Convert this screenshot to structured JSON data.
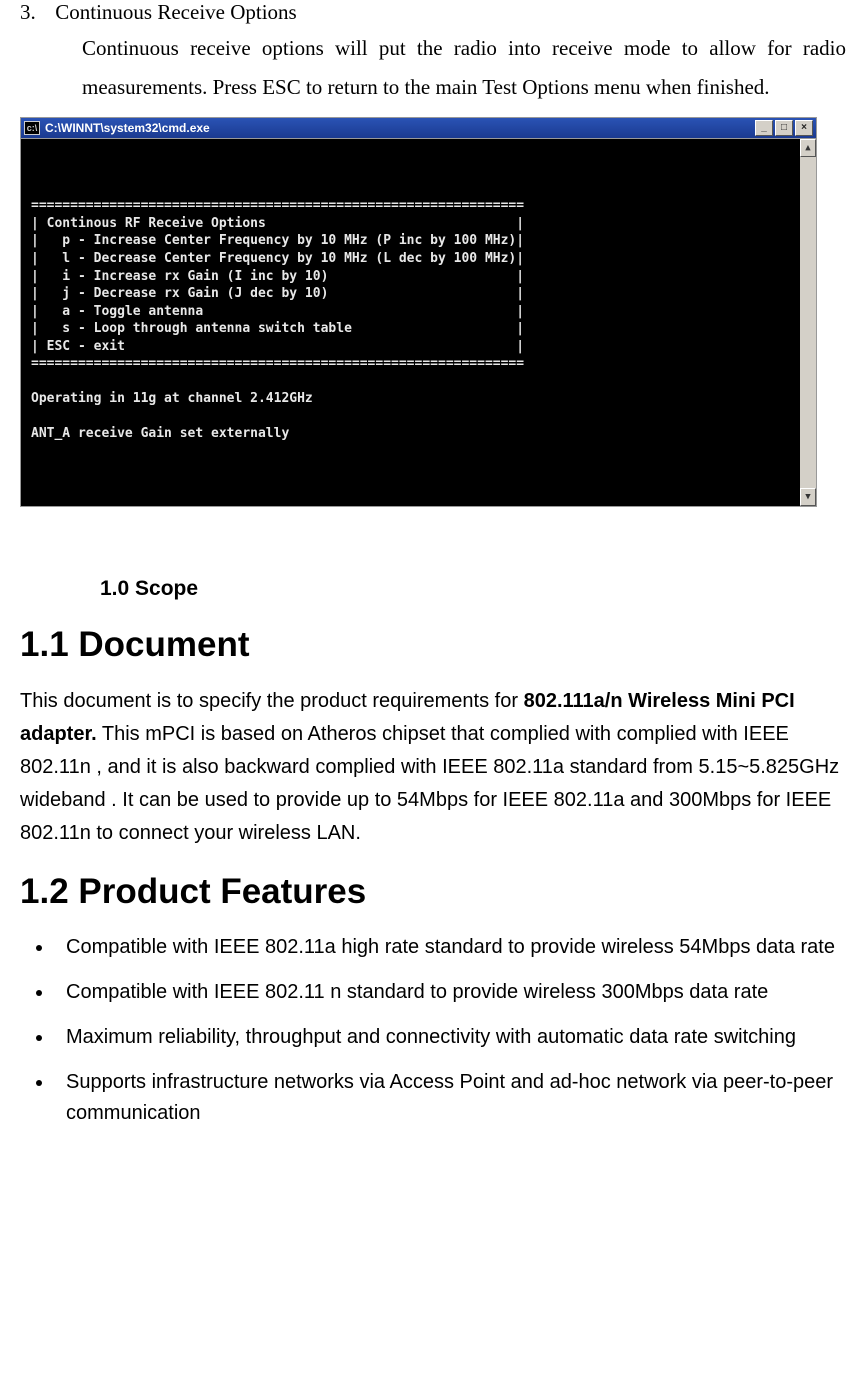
{
  "item3": {
    "marker": "3.",
    "title": "Continuous Receive Options",
    "body": "Continuous receive options will put the radio into receive mode to allow for radio measurements. Press ESC to return to the main Test Options menu when finished."
  },
  "cmd": {
    "title": "C:\\WINNT\\system32\\cmd.exe",
    "sys_icon_label": "c:\\",
    "min": "_",
    "max": "□",
    "close": "×",
    "scroll_up": "▲",
    "scroll_down": "▼",
    "lines": [
      "",
      "===============================================================",
      "| Continous RF Receive Options                                |",
      "|   p - Increase Center Frequency by 10 MHz (P inc by 100 MHz)|",
      "|   l - Decrease Center Frequency by 10 MHz (L dec by 100 MHz)|",
      "|   i - Increase rx Gain (I inc by 10)                        |",
      "|   j - Decrease rx Gain (J dec by 10)                        |",
      "|   a - Toggle antenna                                        |",
      "|   s - Loop through antenna switch table                     |",
      "| ESC - exit                                                  |",
      "===============================================================",
      "",
      "Operating in 11g at channel 2.412GHz",
      "",
      "ANT_A receive Gain set externally"
    ]
  },
  "scope_heading": "1.0 Scope",
  "section11": {
    "heading": "1.1 Document",
    "pre": "This document is to specify the product requirements for ",
    "bold": "802.111a/n Wireless Mini PCI adapter.",
    "post": " This    mPCI is based on Atheros chipset that complied with complied with IEEE 802.11n    , and it is also backward complied with IEEE 802.11a standard from 5.15~5.825GHz wideband . It can be used to provide up to 54Mbps for IEEE 802.11a and 300Mbps for IEEE 802.11n to connect your wireless LAN."
  },
  "section12": {
    "heading": "1.2 Product Features",
    "items": [
      "Compatible with IEEE 802.11a high rate standard to provide wireless 54Mbps data rate",
      "Compatible with IEEE 802.11 n standard to provide wireless 300Mbps data rate",
      "Maximum reliability, throughput and connectivity with automatic data rate switching",
      "Supports infrastructure networks via Access Point and ad-hoc network via peer-to-peer communication"
    ]
  }
}
